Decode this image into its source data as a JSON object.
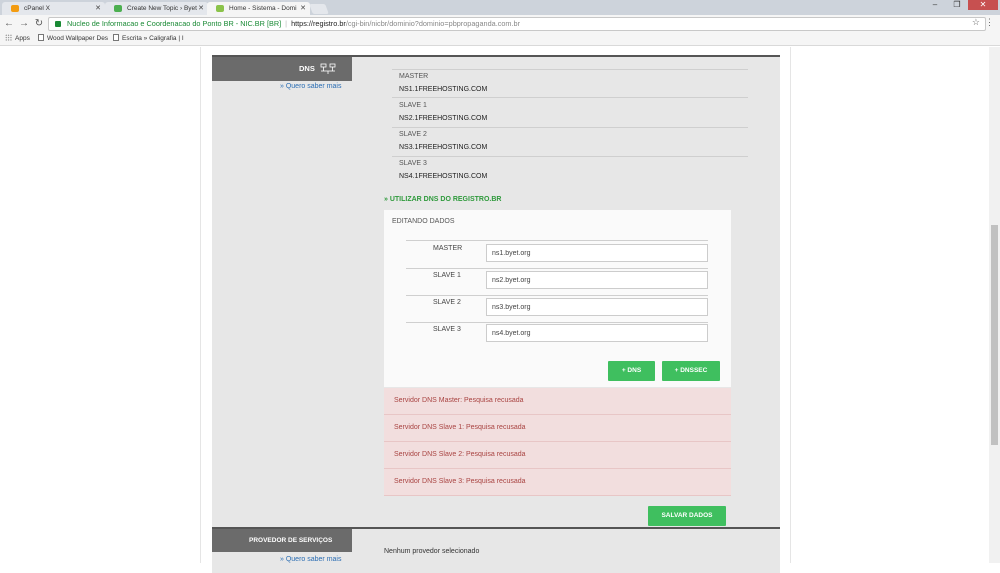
{
  "browser": {
    "tabs": [
      {
        "label": "cPanel X"
      },
      {
        "label": "Create New Topic › Byet"
      },
      {
        "label": "Home - Sistema - Domi"
      }
    ],
    "address": {
      "secure_label": "Nucleo de Informacao e Coordenacao do Ponto BR - NIC.BR [BR]",
      "url_host": "https://registro.br",
      "url_path": "/cgi-bin/nicbr/dominio?dominio=pbpropaganda.com.br"
    },
    "bookmarks": [
      {
        "label": "Apps"
      },
      {
        "label": "Wood Wallpaper Des"
      },
      {
        "label": "Escrita » Caligrafia | I"
      }
    ],
    "icons": {
      "back": "back-arrow-icon",
      "forward": "forward-arrow-icon",
      "reload": "reload-icon",
      "star": "star-icon",
      "menu": "kebab-menu-icon"
    }
  },
  "dns_section": {
    "title": "DNS",
    "help_link": "» Quero saber mais",
    "servers": [
      {
        "label": "MASTER",
        "value": "NS1.1FREEHOSTING.COM"
      },
      {
        "label": "SLAVE 1",
        "value": "NS2.1FREEHOSTING.COM"
      },
      {
        "label": "SLAVE 2",
        "value": "NS3.1FREEHOSTING.COM"
      },
      {
        "label": "SLAVE 3",
        "value": "NS4.1FREEHOSTING.COM"
      }
    ],
    "use_registro_link": "» UTILIZAR DNS DO REGISTRO.BR",
    "edit": {
      "title": "EDITANDO DADOS",
      "fields": [
        {
          "label": "MASTER",
          "value": "ns1.byet.org"
        },
        {
          "label": "SLAVE 1",
          "value": "ns2.byet.org"
        },
        {
          "label": "SLAVE 2",
          "value": "ns3.byet.org"
        },
        {
          "label": "SLAVE 3",
          "value": "ns4.byet.org"
        }
      ],
      "add_dns_button": "+ DNS",
      "add_dnssec_button": "+ DNSSEC"
    },
    "errors": [
      "Servidor DNS Master: Pesquisa recusada",
      "Servidor DNS Slave 1: Pesquisa recusada",
      "Servidor DNS Slave 2: Pesquisa recusada",
      "Servidor DNS Slave 3: Pesquisa recusada"
    ],
    "save_button": "SALVAR DADOS"
  },
  "provider_section": {
    "title": "PROVEDOR DE SERVIÇOS",
    "help_link": "» Quero saber mais",
    "status": "Nenhum provedor selecionado"
  },
  "colors": {
    "accent_green": "#3fbf5f",
    "link_blue": "#2a6db3",
    "error_bg": "#f2dede",
    "error_text": "#a94442",
    "header_gray": "#6b6b6b"
  }
}
